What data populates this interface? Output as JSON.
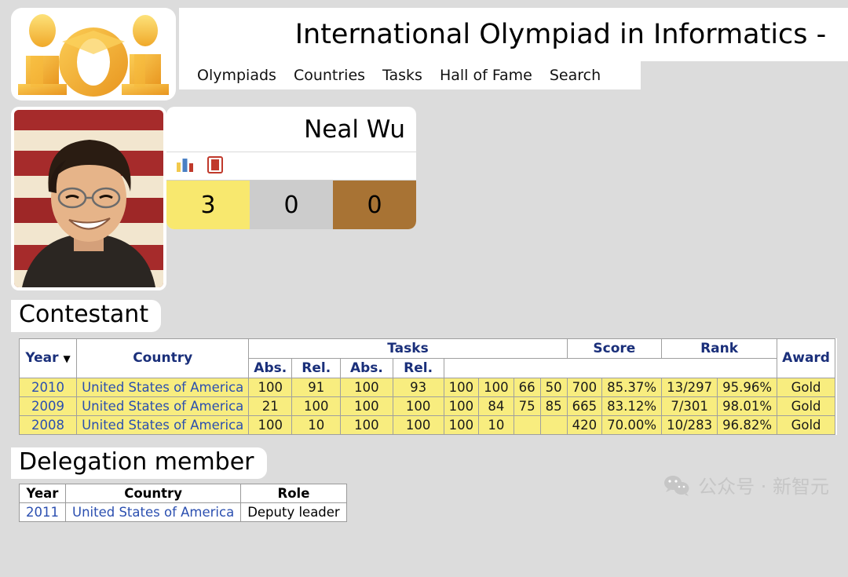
{
  "header": {
    "site_title": "International Olympiad in Informatics -",
    "logo_text": "ioi",
    "nav": [
      {
        "label": "Olympiads"
      },
      {
        "label": "Countries"
      },
      {
        "label": "Tasks"
      },
      {
        "label": "Hall of Fame"
      },
      {
        "label": "Search"
      }
    ]
  },
  "profile": {
    "name": "Neal Wu",
    "icons": [
      {
        "name": "statistics-bar-chart-icon"
      },
      {
        "name": "red-book-icon"
      }
    ],
    "medals": [
      {
        "type": "gold",
        "count": "3",
        "color": "#f8e86e"
      },
      {
        "type": "silver",
        "count": "0",
        "color": "#cccccc"
      },
      {
        "type": "bronze",
        "count": "0",
        "color": "#a87334"
      }
    ]
  },
  "contestant": {
    "section_title": "Contestant",
    "headers": {
      "year": "Year",
      "sort_arrow": "▼",
      "country": "Country",
      "tasks": "Tasks",
      "score": "Score",
      "rank": "Rank",
      "award": "Award",
      "abs": "Abs.",
      "rel": "Rel."
    },
    "rows": [
      {
        "year": "2010",
        "country": "United States of America",
        "tasks": [
          "100",
          "91",
          "100",
          "93",
          "100",
          "100",
          "66",
          "50"
        ],
        "score_abs": "700",
        "score_rel": "85.37%",
        "rank_abs": "13/297",
        "rank_rel": "95.96%",
        "award": "Gold"
      },
      {
        "year": "2009",
        "country": "United States of America",
        "tasks": [
          "21",
          "100",
          "100",
          "100",
          "100",
          "84",
          "75",
          "85"
        ],
        "score_abs": "665",
        "score_rel": "83.12%",
        "rank_abs": "7/301",
        "rank_rel": "98.01%",
        "award": "Gold"
      },
      {
        "year": "2008",
        "country": "United States of America",
        "tasks": [
          "100",
          "10",
          "100",
          "100",
          "100",
          "10",
          "",
          ""
        ],
        "score_abs": "420",
        "score_rel": "70.00%",
        "rank_abs": "10/283",
        "rank_rel": "96.82%",
        "award": "Gold"
      }
    ]
  },
  "delegation": {
    "section_title": "Delegation member",
    "headers": {
      "year": "Year",
      "country": "Country",
      "role": "Role"
    },
    "rows": [
      {
        "year": "2011",
        "country": "United States of America",
        "role": "Deputy leader"
      }
    ]
  },
  "watermark": {
    "text": "公众号 · 新智元"
  }
}
